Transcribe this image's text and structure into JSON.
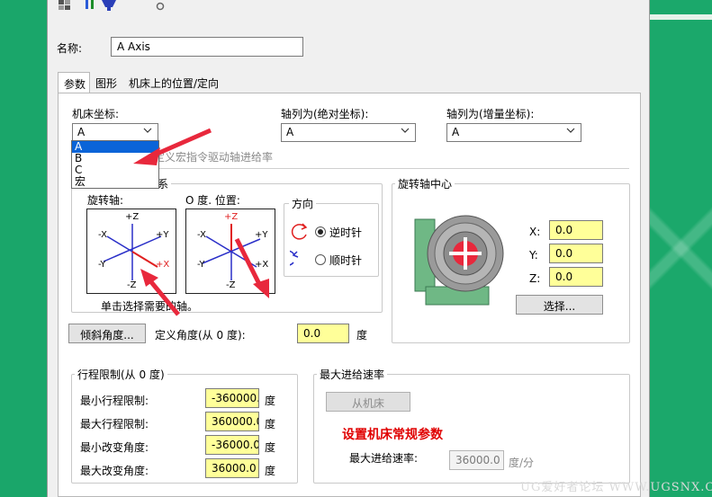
{
  "dialog": {
    "name_label": "名称:",
    "name_value": "A Axis",
    "tabs": [
      {
        "label": "参数",
        "active": true
      },
      {
        "label": "图形",
        "active": false
      },
      {
        "label": "机床上的位置/定向",
        "active": false
      }
    ]
  },
  "params": {
    "machine_coord_label": "机床坐标:",
    "machine_coord_value": "A",
    "machine_coord_options": [
      "A",
      "B",
      "C",
      "宏"
    ],
    "abs_coord_label": "轴列为(绝对坐标):",
    "abs_coord_value": "A",
    "inc_coord_label": "轴列为(增量坐标):",
    "inc_coord_value": "A",
    "macro_feed_text": "用户定义宏指令驱动轴进给率",
    "coord_system_label": "标系",
    "rotary_axis_label": "旋转轴:",
    "zero_pos_label": "O 度. 位置:",
    "direction_label": "方向",
    "ccw_label": "逆时针",
    "cw_label": "顺时针",
    "select_axis_hint": "单击选择需要的轴。",
    "tilt_button": "倾斜角度...",
    "define_angle_label": "定义角度(从 0 度):",
    "define_angle_value": "0.0",
    "degree_unit": "度",
    "axis_labels": {
      "pz": "+Z",
      "nz": "-Z",
      "px": "+X",
      "nx": "-X",
      "py": "+Y",
      "ny": "-Y"
    }
  },
  "center": {
    "title": "旋转轴中心",
    "x_label": "X:",
    "x_value": "0.0",
    "y_label": "Y:",
    "y_value": "0.0",
    "z_label": "Z:",
    "z_value": "0.0",
    "select_button": "选择..."
  },
  "limits": {
    "title": "行程限制(从 0 度)",
    "rows": [
      {
        "label": "最小行程限制:",
        "value": "-360000.0",
        "unit": "度"
      },
      {
        "label": "最大行程限制:",
        "value": "360000.0",
        "unit": "度"
      },
      {
        "label": "最小改变角度:",
        "value": "-36000.0",
        "unit": "度"
      },
      {
        "label": "最大改变角度:",
        "value": "36000.0",
        "unit": "度"
      }
    ]
  },
  "feed": {
    "title": "最大进给速率",
    "from_machine_button": "从机床",
    "annotation": "设置机床常规参数",
    "max_feed_label": "最大进给速率:",
    "max_feed_value": "36000.0",
    "max_feed_unit": "度/分"
  },
  "watermark": "UG爱好者论坛 WWW.UGSNX.COM",
  "colors": {
    "accent": "#0a64d8",
    "highlight_field": "#ffff99",
    "arrow": "#e8283c",
    "machine_green": "#6fb885"
  }
}
